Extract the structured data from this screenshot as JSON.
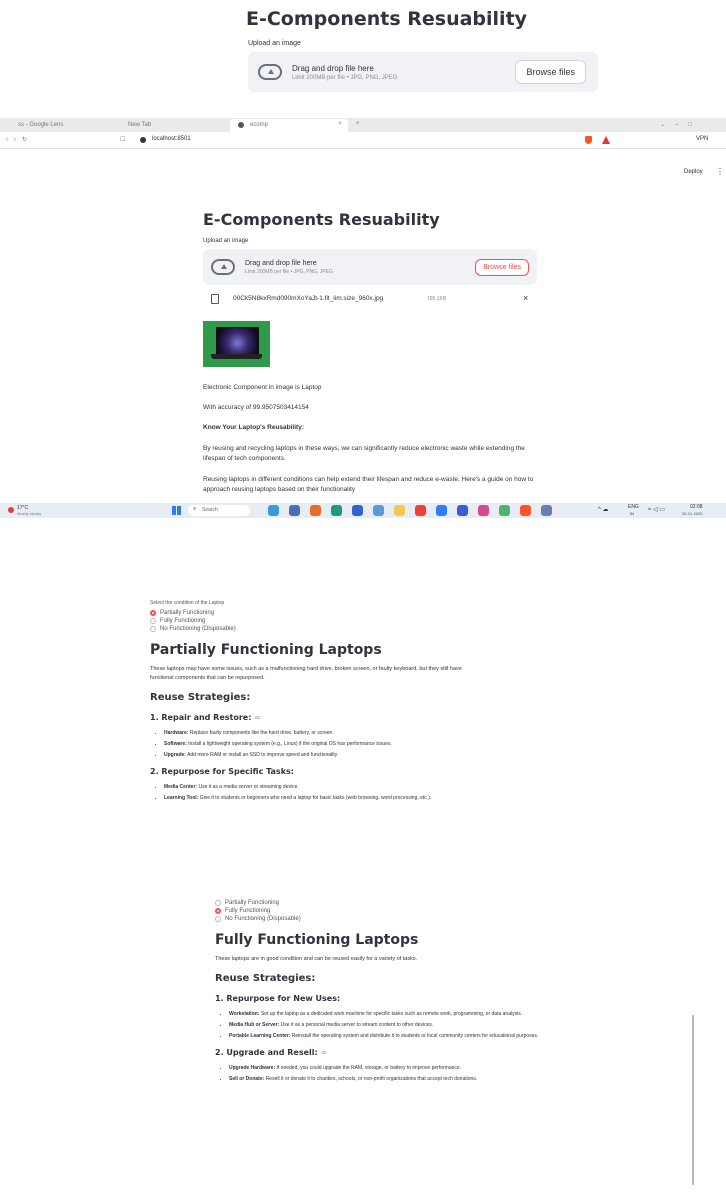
{
  "section1": {
    "title": "E-Components Resuability",
    "upload_label": "Upload an image",
    "drop_text": "Drag and drop file here",
    "limit_text": "Limit 200MB per file • JPG, PNG, JPEG",
    "browse_label": "Browse files"
  },
  "browser": {
    "tabs": [
      "ss - Google Lens",
      "New Tab",
      "ecomp",
      "+"
    ],
    "url": "localhost:8501",
    "toolbar_text": "VPN",
    "deploy_label": "Deploy"
  },
  "app": {
    "title": "E-Components Resuability",
    "upload_label": "Upload an image",
    "drop_text": "Drag and drop file here",
    "limit_text": "Limit 200MB per file • JPG, PNG, JPEG",
    "browse_label": "Browse files",
    "file_name": "00Ck5N8kxRmd090mXoYaJt-1.fit_lim.size_960x.jpg",
    "file_size": "195.1KB",
    "result_component": "Electronic Component in image is Laptop",
    "result_accuracy": "With accuracy of 99.9507503414154",
    "know_heading": "Know Your Laptop's Reusability:",
    "para1": "By reusing and recycling laptops in these ways, we can significantly reduce electronic waste while extending the lifespan of tech components.",
    "para2": "Reusing laptops in different conditions can help extend their lifespan and reduce e-waste. Here's a guide on how to approach reusing laptops based on their functionality"
  },
  "taskbar": {
    "weather_temp": "17°C",
    "weather_desc": "Mostly cloudy",
    "search_placeholder": "Search",
    "lang": "ENG",
    "lang_sub": "IN",
    "time": "02:08",
    "date": "05-01-2025"
  },
  "section3": {
    "select_label": "Select the condition of the Laptop",
    "options": [
      "Partially Functioning",
      "Fully Functioning",
      "No Functioning (Disposable)"
    ],
    "heading": "Partially Functioning Laptops",
    "intro": "These laptops may have some issues, such as a malfunctioning hard drive, broken screen, or faulty keyboard, but they still have functional components that can be repurposed.",
    "reuse_heading": "Reuse Strategies:",
    "s1_heading": "1. Repair and Restore:",
    "s1_items": [
      {
        "label": "Hardware:",
        "text": " Replace faulty components like the hard drive, battery, or screen."
      },
      {
        "label": "Software:",
        "text": " Install a lightweight operating system (e.g., Linux) if the original OS has performance issues."
      },
      {
        "label": "Upgrade:",
        "text": " Add more RAM or install an SSD to improve speed and functionality."
      }
    ],
    "s2_heading": "2. Repurpose for Specific Tasks:",
    "s2_items": [
      {
        "label": "Media Center:",
        "text": " Use it as a media server or streaming device."
      },
      {
        "label": "Learning Tool:",
        "text": " Give it to students or beginners who need a laptop for basic tasks (web browsing, word processing, etc.)."
      }
    ]
  },
  "section4": {
    "options": [
      "Partially Functioning",
      "Fully Functioning",
      "No Functioning (Disposable)"
    ],
    "heading": "Fully Functioning Laptops",
    "intro": "These laptops are in good condition and can be reused easily for a variety of tasks.",
    "reuse_heading": "Reuse Strategies:",
    "s1_heading": "1. Repurpose for New Uses:",
    "s1_items": [
      {
        "label": "Workstation:",
        "text": " Set up the laptop as a dedicated work machine for specific tasks such as remote work, programming, or data analysis."
      },
      {
        "label": "Media Hub or Server:",
        "text": " Use it as a personal media server to stream content to other devices."
      },
      {
        "label": "Portable Learning Center:",
        "text": " Reinstall the operating system and distribute it to students or local community centers for educational purposes."
      }
    ],
    "s2_heading": "2. Upgrade and Resell:",
    "s2_items": [
      {
        "label": "Upgrade Hardware:",
        "text": " If needed, you could upgrade the RAM, storage, or battery to improve performance."
      },
      {
        "label": "Sell or Donate:",
        "text": " Resell it or donate it to charities, schools, or non-profit organizations that accept tech donations."
      }
    ]
  }
}
